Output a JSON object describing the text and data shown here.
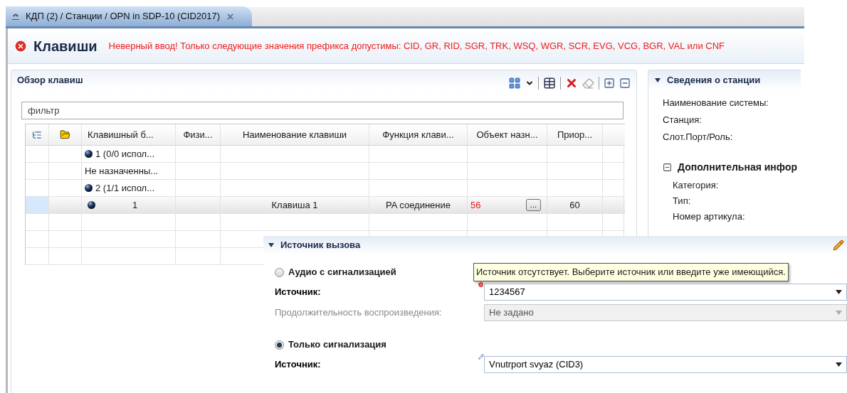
{
  "tab": {
    "title": "КДП (2) / Станции / OPN in SDP-10 (CID2017)",
    "selected": true
  },
  "editor": {
    "title": "Клавиши",
    "error": "Неверный ввод! Только следующие значения префикса допустимы: CID, GR, RID, SGR, TRK, WSQ, WGR, SCR, EVG, VCG, BGR, VAL или CNF"
  },
  "overview": {
    "title": "Обзор клавиш",
    "filter": {
      "placeholder": "фильтр"
    },
    "table": {
      "columns": [
        "Клавишный б...",
        "Физи...",
        "Наименование клавиши",
        "Функция клави...",
        "Объект назн...",
        "Приор..."
      ],
      "rows": [
        {
          "kind": "group",
          "selected": false,
          "ball": true,
          "block": "1 (0/0 испол..."
        },
        {
          "kind": "group",
          "selected": false,
          "ball": false,
          "block": "Не назначенны..."
        },
        {
          "kind": "group",
          "selected": false,
          "ball": true,
          "block": "2 (1/1 испол..."
        },
        {
          "kind": "key",
          "selected": true,
          "ball": true,
          "block": "1",
          "name": "Клавиша 1",
          "function": "PA соединение",
          "object": "56",
          "object_invalid": true,
          "browse": "...",
          "priority": "60"
        }
      ]
    }
  },
  "station": {
    "title": "Сведения о станции",
    "expanded": true,
    "fields": [
      "Наименование системы:",
      "Станция:",
      "Слот.Порт/Роль:"
    ],
    "more": {
      "title": "Дополнительная инфор",
      "expanded": true,
      "fields": [
        "Категория:",
        "Тип:",
        "Номер артикула:"
      ]
    }
  },
  "call_source": {
    "title": "Источник вызова",
    "expanded": true,
    "tooltip": "Источник отсутствует. Выберите источник или введите уже имеющийся.",
    "options": [
      {
        "label": "Аудио с сигнализацией",
        "selected": false,
        "fields": [
          {
            "label": "Источник:",
            "value": "1234567",
            "disabled": false,
            "invalid": true,
            "edited": false
          },
          {
            "label": "Продолжительность воспроизведения:",
            "value": "Не задано",
            "disabled": true
          }
        ]
      },
      {
        "label": "Только сигнализация",
        "selected": true,
        "fields": [
          {
            "label": "Источник:",
            "value": "Vnutrport svyaz (CID3)",
            "disabled": false,
            "invalid": false,
            "edited": true
          }
        ]
      }
    ]
  }
}
